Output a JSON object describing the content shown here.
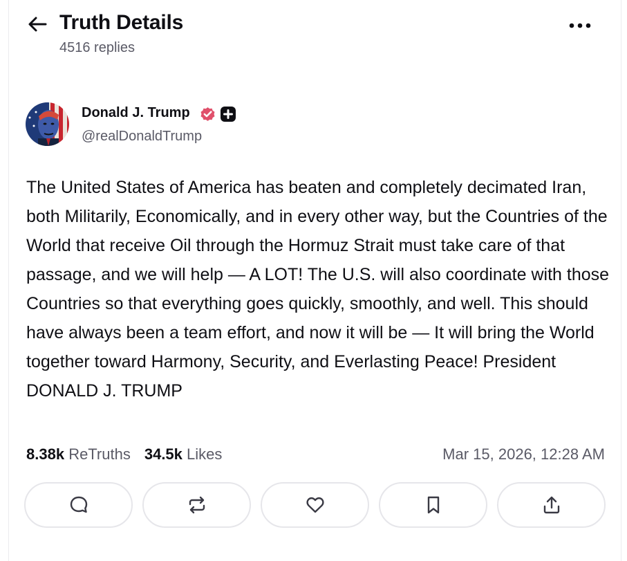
{
  "header": {
    "title": "Truth Details",
    "reply_count": "4516 replies",
    "back_icon": "arrow-left-icon",
    "more_icon": "more-horizontal-icon"
  },
  "author": {
    "name": "Donald J. Trump",
    "handle": "@realDonaldTrump",
    "verified_color": "#e0506b",
    "badges": [
      "verified-icon",
      "plus-badge-icon"
    ]
  },
  "post": {
    "text": "The United States of America has beaten and completely decimated Iran, both Militarily, Economically, and in every other way, but the Countries of the World that receive Oil through the Hormuz Strait must take care of that passage, and we will help — A LOT! The U.S. will also coordinate with those Countries so that everything goes quickly, smoothly, and well. This should have always been a team effort, and now it will be — It will bring the World together toward Harmony, Security, and Everlasting Peace! President DONALD J. TRUMP"
  },
  "stats": {
    "retruths_count": "8.38k",
    "retruths_label": "ReTruths",
    "likes_count": "34.5k",
    "likes_label": "Likes",
    "timestamp": "Mar 15, 2026, 12:28 AM"
  },
  "actions": [
    {
      "icon": "reply-icon"
    },
    {
      "icon": "retruth-icon"
    },
    {
      "icon": "like-heart-icon"
    },
    {
      "icon": "bookmark-icon"
    },
    {
      "icon": "share-upload-icon"
    }
  ],
  "colors": {
    "text_primary": "#0f0f14",
    "text_secondary": "#5a5a66",
    "border": "#e6e6ea"
  }
}
